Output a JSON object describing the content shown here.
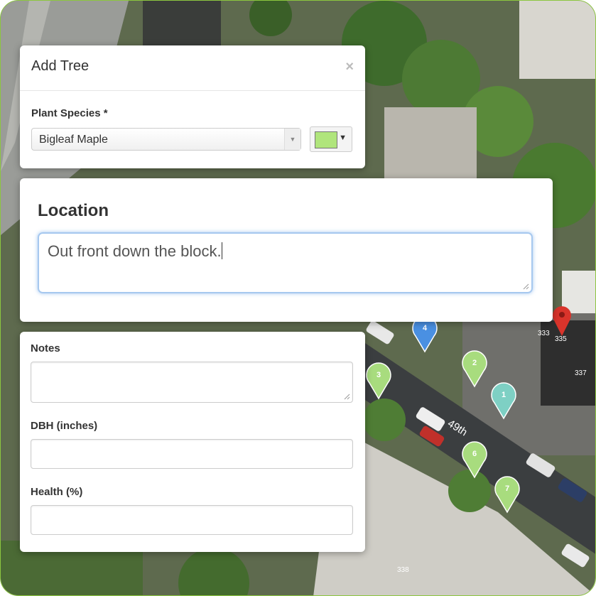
{
  "add_tree": {
    "title": "Add Tree",
    "close_label": "×",
    "species_label": "Plant Species *",
    "species_value": "Bigleaf Maple",
    "swatch_color": "#b0e57c"
  },
  "location": {
    "label": "Location",
    "value": "Out front down the block."
  },
  "details": {
    "notes_label": "Notes",
    "notes_value": "",
    "dbh_label": "DBH (inches)",
    "dbh_value": "",
    "health_label": "Health (%)",
    "health_value": ""
  },
  "map": {
    "street_label": "49th",
    "addresses": [
      "333",
      "335",
      "337",
      "338"
    ],
    "tree_pins": [
      {
        "num": "1",
        "color": "#7ed0c4"
      },
      {
        "num": "2",
        "color": "#a8dc7e"
      },
      {
        "num": "3",
        "color": "#a8dc7e"
      },
      {
        "num": "6",
        "color": "#a8dc7e"
      },
      {
        "num": "7",
        "color": "#a8dc7e"
      },
      {
        "num": "4",
        "color": "#4a90e2"
      }
    ],
    "selected_pin_color": "#d9342b"
  }
}
